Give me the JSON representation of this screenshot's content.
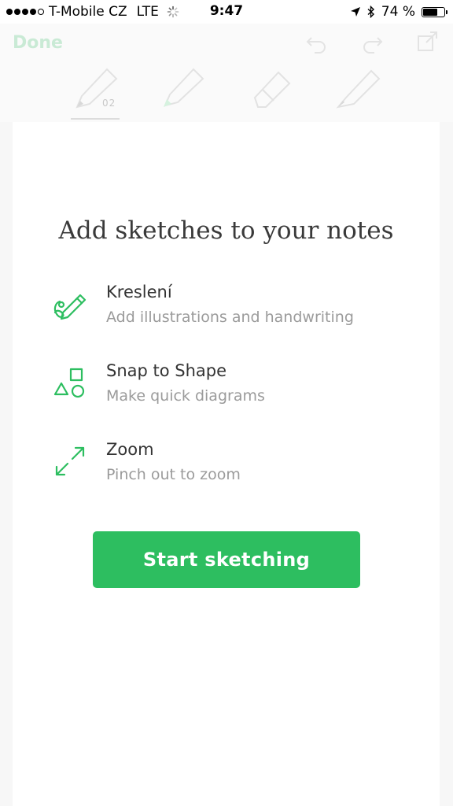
{
  "status_bar": {
    "carrier": "T-Mobile CZ",
    "network": "LTE",
    "time": "9:47",
    "battery_text": "74 %",
    "battery_level": 0.74,
    "signal_bars_filled": 4,
    "signal_bars_total": 5
  },
  "toolbar": {
    "done_label": "Done",
    "pen_count": "02",
    "icons": [
      "undo-icon",
      "redo-icon",
      "export-icon",
      "pencil-icon",
      "highlighter-icon",
      "eraser-icon",
      "pen-icon"
    ]
  },
  "onboarding": {
    "title": "Add sketches to your notes",
    "features": [
      {
        "icon": "sketch-pen-icon",
        "title": "Kreslení",
        "description": "Add illustrations and handwriting"
      },
      {
        "icon": "shapes-icon",
        "title": "Snap to Shape",
        "description": "Make quick diagrams"
      },
      {
        "icon": "zoom-arrows-icon",
        "title": "Zoom",
        "description": "Pinch out to zoom"
      }
    ],
    "start_button_label": "Start sketching"
  },
  "colors": {
    "accent": "#2dbe60",
    "title_text": "#3a3a3a",
    "description_text": "#9b9b9b",
    "faded_done": "#c9ead5"
  }
}
